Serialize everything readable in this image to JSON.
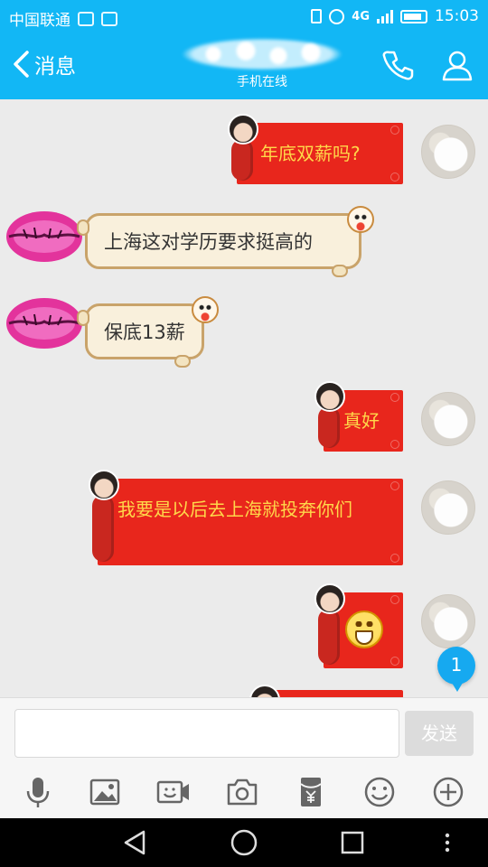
{
  "status_bar": {
    "carrier": "中国联通",
    "network": "4G",
    "time": "15:03",
    "icons": [
      "notification-icon",
      "screenshot-icon",
      "vibrate-icon",
      "alarm-icon",
      "signal-icon",
      "battery-icon"
    ]
  },
  "header": {
    "back_label": "消息",
    "subtitle": "手机在线",
    "call_icon": "phone-icon",
    "profile_icon": "person-icon"
  },
  "messages": [
    {
      "side": "right",
      "text": "年底双薪吗?"
    },
    {
      "side": "left",
      "text": "上海这对学历要求挺高的"
    },
    {
      "side": "left",
      "text": "保底13薪"
    },
    {
      "side": "right",
      "text": "真好"
    },
    {
      "side": "right",
      "text": "我要是以后去上海就投奔你们"
    },
    {
      "side": "right",
      "text": "",
      "emoji": "grinning-face"
    }
  ],
  "unread_count": "1",
  "input": {
    "value": "",
    "send_label": "发送"
  },
  "toolbar": [
    "microphone-icon",
    "image-icon",
    "video-icon",
    "camera-icon",
    "red-packet-icon",
    "emoji-icon",
    "plus-icon"
  ],
  "navbar": [
    "back-triangle-icon",
    "home-circle-icon",
    "recents-square-icon",
    "menu-dots-icon"
  ],
  "colors": {
    "accent": "#12b7f5",
    "bubble_red": "#e8261c",
    "bubble_text": "#ffd84a",
    "scroll_bg": "#f9f0dc"
  }
}
